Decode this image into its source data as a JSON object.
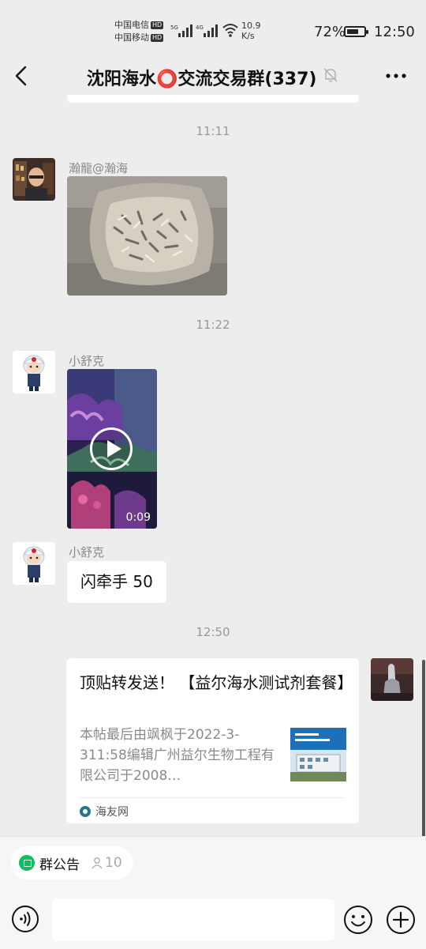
{
  "status_bar": {
    "carrier1": "中国电信",
    "carrier2": "中国移动",
    "hd": "HD",
    "net1": "5G",
    "net2": "4G",
    "speed_value": "10.9",
    "speed_unit": "K/s",
    "battery": "72%",
    "battery_level": 0.72,
    "time": "12:50"
  },
  "header": {
    "title": "沈阳海水⭕交流交易群(337)",
    "icons": {
      "back": "chevron-left-icon",
      "mute": "bell-off-icon",
      "more": "more-dots-icon"
    }
  },
  "messages": [
    {
      "type": "timestamp",
      "text": "11:11"
    },
    {
      "type": "image",
      "sender": "瀚龍@瀚海"
    },
    {
      "type": "timestamp",
      "text": "11:22"
    },
    {
      "type": "video",
      "sender": "小舒克",
      "duration": "0:09"
    },
    {
      "type": "text",
      "sender": "小舒克",
      "text": "闪牵手 50"
    },
    {
      "type": "timestamp",
      "text": "12:50"
    },
    {
      "type": "link",
      "from_me": true,
      "title": "顶贴转发送！ 【益尔海水测试剂套餐】",
      "description": "本帖最后由飒枫于2022-3-311:58编辑广州益尔生物工程有限公司于2008…",
      "source": "海友网"
    }
  ],
  "footer": {
    "notice_label": "群公告",
    "notice_count": "10",
    "input_value": "",
    "icons": {
      "voice": "voice-icon",
      "emoji": "emoji-icon",
      "plus": "plus-icon"
    }
  },
  "colors": {
    "background": "#ededed",
    "accent": "#07c160",
    "bubble": "#ffffff"
  }
}
